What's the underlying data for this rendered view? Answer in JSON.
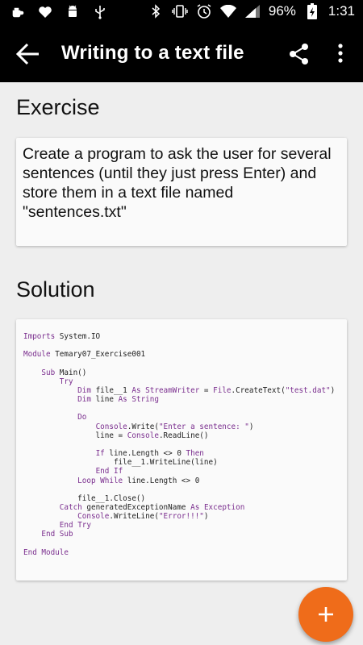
{
  "status_bar": {
    "battery": "96%",
    "time": "1:31",
    "left_icons": [
      "kettle-icon",
      "heart-icon",
      "android-icon",
      "usb-icon"
    ],
    "right_icons": [
      "bluetooth-icon",
      "vibrate-icon",
      "alarm-icon",
      "wifi-icon",
      "signal-icon",
      "battery-icon"
    ]
  },
  "toolbar": {
    "title": "Writing to a text file",
    "background": "#000000"
  },
  "exercise": {
    "heading": "Exercise",
    "text": "Create a program to ask the user for several sentences (until they just press Enter) and store them in a text file named \"sentences.txt\""
  },
  "solution": {
    "heading": "Solution",
    "code_lines": [
      "Imports System.IO",
      "",
      "Module Temary07_Exercise001",
      "",
      "    Sub Main()",
      "        Try",
      "            Dim file__1 As StreamWriter = File.CreateText(\"test.dat\")",
      "            Dim line As String",
      "",
      "            Do",
      "                Console.Write(\"Enter a sentence: \")",
      "                line = Console.ReadLine()",
      "",
      "                If line.Length <> 0 Then",
      "                    file__1.WriteLine(line)",
      "                End If",
      "            Loop While line.Length <> 0",
      "",
      "            file__1.Close()",
      "        Catch generatedExceptionName As Exception",
      "            Console.WriteLine(\"Error!!!\")",
      "        End Try",
      "    End Sub",
      "",
      "End Module"
    ]
  },
  "fab": {
    "icon": "plus-icon",
    "color": "#ef6c1a"
  }
}
